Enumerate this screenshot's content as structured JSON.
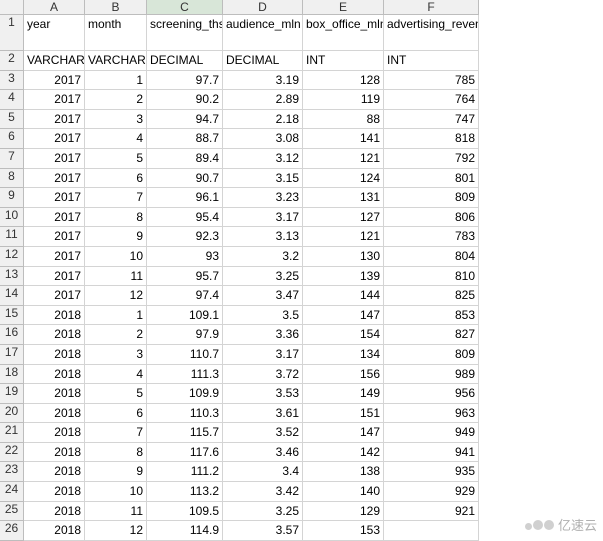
{
  "columns": [
    "A",
    "B",
    "C",
    "D",
    "E",
    "F"
  ],
  "active_column": "C",
  "headers": {
    "A": "year",
    "B": "month",
    "C": "screening_ths",
    "D": "audience_mln",
    "E": "box_office_mln",
    "F": "advertising_revenue_mln"
  },
  "types": {
    "A": "VARCHAR",
    "B": "VARCHAR",
    "C": "DECIMAL",
    "D": "DECIMAL",
    "E": "INT",
    "F": "INT"
  },
  "rows": [
    {
      "n": 3,
      "A": "2017",
      "B": "1",
      "C": "97.7",
      "D": "3.19",
      "E": "128",
      "F": "785"
    },
    {
      "n": 4,
      "A": "2017",
      "B": "2",
      "C": "90.2",
      "D": "2.89",
      "E": "119",
      "F": "764"
    },
    {
      "n": 5,
      "A": "2017",
      "B": "3",
      "C": "94.7",
      "D": "2.18",
      "E": "88",
      "F": "747"
    },
    {
      "n": 6,
      "A": "2017",
      "B": "4",
      "C": "88.7",
      "D": "3.08",
      "E": "141",
      "F": "818"
    },
    {
      "n": 7,
      "A": "2017",
      "B": "5",
      "C": "89.4",
      "D": "3.12",
      "E": "121",
      "F": "792"
    },
    {
      "n": 8,
      "A": "2017",
      "B": "6",
      "C": "90.7",
      "D": "3.15",
      "E": "124",
      "F": "801"
    },
    {
      "n": 9,
      "A": "2017",
      "B": "7",
      "C": "96.1",
      "D": "3.23",
      "E": "131",
      "F": "809"
    },
    {
      "n": 10,
      "A": "2017",
      "B": "8",
      "C": "95.4",
      "D": "3.17",
      "E": "127",
      "F": "806"
    },
    {
      "n": 11,
      "A": "2017",
      "B": "9",
      "C": "92.3",
      "D": "3.13",
      "E": "121",
      "F": "783"
    },
    {
      "n": 12,
      "A": "2017",
      "B": "10",
      "C": "93",
      "D": "3.2",
      "E": "130",
      "F": "804"
    },
    {
      "n": 13,
      "A": "2017",
      "B": "11",
      "C": "95.7",
      "D": "3.25",
      "E": "139",
      "F": "810"
    },
    {
      "n": 14,
      "A": "2017",
      "B": "12",
      "C": "97.4",
      "D": "3.47",
      "E": "144",
      "F": "825"
    },
    {
      "n": 15,
      "A": "2018",
      "B": "1",
      "C": "109.1",
      "D": "3.5",
      "E": "147",
      "F": "853"
    },
    {
      "n": 16,
      "A": "2018",
      "B": "2",
      "C": "97.9",
      "D": "3.36",
      "E": "154",
      "F": "827"
    },
    {
      "n": 17,
      "A": "2018",
      "B": "3",
      "C": "110.7",
      "D": "3.17",
      "E": "134",
      "F": "809"
    },
    {
      "n": 18,
      "A": "2018",
      "B": "4",
      "C": "111.3",
      "D": "3.72",
      "E": "156",
      "F": "989"
    },
    {
      "n": 19,
      "A": "2018",
      "B": "5",
      "C": "109.9",
      "D": "3.53",
      "E": "149",
      "F": "956"
    },
    {
      "n": 20,
      "A": "2018",
      "B": "6",
      "C": "110.3",
      "D": "3.61",
      "E": "151",
      "F": "963"
    },
    {
      "n": 21,
      "A": "2018",
      "B": "7",
      "C": "115.7",
      "D": "3.52",
      "E": "147",
      "F": "949"
    },
    {
      "n": 22,
      "A": "2018",
      "B": "8",
      "C": "117.6",
      "D": "3.46",
      "E": "142",
      "F": "941"
    },
    {
      "n": 23,
      "A": "2018",
      "B": "9",
      "C": "111.2",
      "D": "3.4",
      "E": "138",
      "F": "935"
    },
    {
      "n": 24,
      "A": "2018",
      "B": "10",
      "C": "113.2",
      "D": "3.42",
      "E": "140",
      "F": "929"
    },
    {
      "n": 25,
      "A": "2018",
      "B": "11",
      "C": "109.5",
      "D": "3.25",
      "E": "129",
      "F": "921"
    },
    {
      "n": 26,
      "A": "2018",
      "B": "12",
      "C": "114.9",
      "D": "3.57",
      "E": "153",
      "F": ""
    }
  ],
  "watermark": "亿速云"
}
